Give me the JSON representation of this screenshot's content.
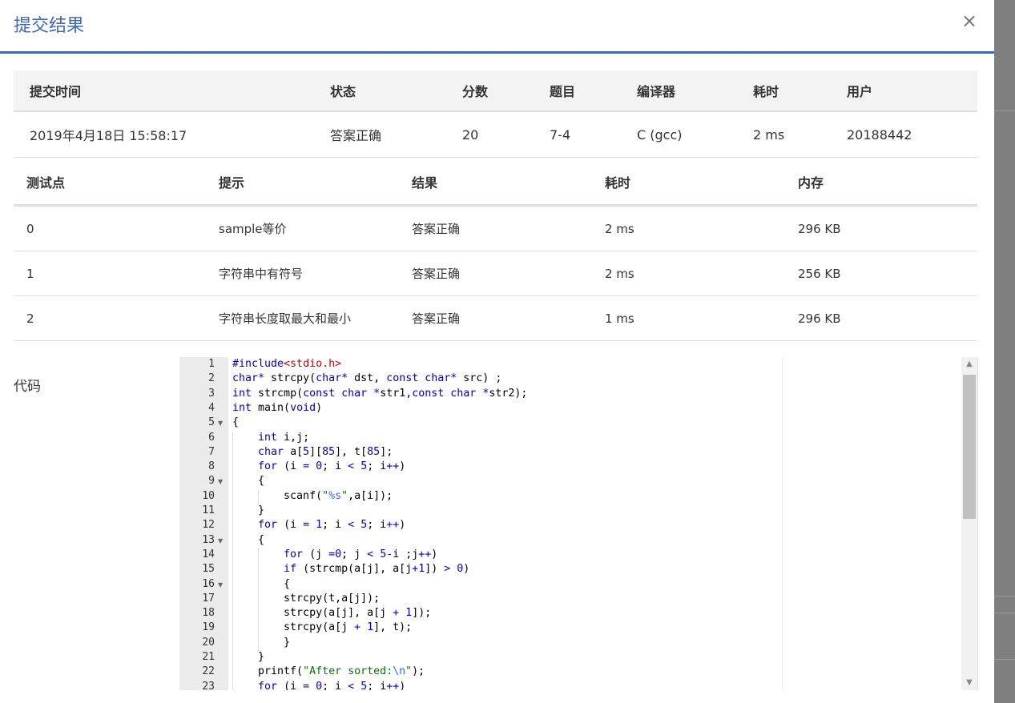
{
  "dialog": {
    "title": "提交结果",
    "close_icon": "×"
  },
  "summary": {
    "headers": [
      "提交时间",
      "状态",
      "分数",
      "题目",
      "编译器",
      "耗时",
      "用户"
    ],
    "row": {
      "time": "2019年4月18日 15:58:17",
      "status": "答案正确",
      "score": "20",
      "problem": "7-4",
      "compiler": "C (gcc)",
      "duration": "2 ms",
      "user": "20188442"
    }
  },
  "tests": {
    "headers": [
      "测试点",
      "提示",
      "结果",
      "耗时",
      "内存"
    ],
    "rows": [
      {
        "id": "0",
        "hint": "sample等价",
        "result": "答案正确",
        "time": "2 ms",
        "memory": "296 KB"
      },
      {
        "id": "1",
        "hint": "字符串中有符号",
        "result": "答案正确",
        "time": "2 ms",
        "memory": "256 KB"
      },
      {
        "id": "2",
        "hint": "字符串长度取最大和最小",
        "result": "答案正确",
        "time": "1 ms",
        "memory": "296 KB"
      }
    ]
  },
  "code": {
    "label": "代码",
    "line_numbers": [
      "1",
      "2",
      "3",
      "4",
      "5",
      "6",
      "7",
      "8",
      "9",
      "10",
      "11",
      "12",
      "13",
      "14",
      "15",
      "16",
      "17",
      "18",
      "19",
      "20",
      "21",
      "22",
      "23"
    ],
    "fold_lines": [
      "5",
      "9",
      "13",
      "16"
    ],
    "lines": [
      "#include<stdio.h>",
      "char* strcpy(char* dst, const char* src) ;",
      "int strcmp(const char *str1,const char *str2);",
      "int main(void)",
      "{",
      "    int i,j;",
      "    char a[5][85], t[85];",
      "    for (i = 0; i < 5; i++)",
      "    {",
      "        scanf(\"%s\",a[i]);",
      "    }",
      "    for (i = 1; i < 5; i++)",
      "    {",
      "        for (j =0; j < 5-i ;j++)",
      "        if (strcmp(a[j], a[j+1]) > 0)",
      "        {",
      "        strcpy(t,a[j]);",
      "        strcpy(a[j], a[j + 1]);",
      "        strcpy(a[j + 1], t);",
      "        }",
      "    }",
      "    printf(\"After sorted:\\n\");",
      "    for (i = 0; i < 5; i++)"
    ]
  },
  "colors": {
    "accent": "#3d67c0",
    "status_ok": "#e23c3c",
    "link": "#2c5aa0",
    "keyword": "#0000cc",
    "string": "#007700",
    "include": "#cc0000"
  }
}
